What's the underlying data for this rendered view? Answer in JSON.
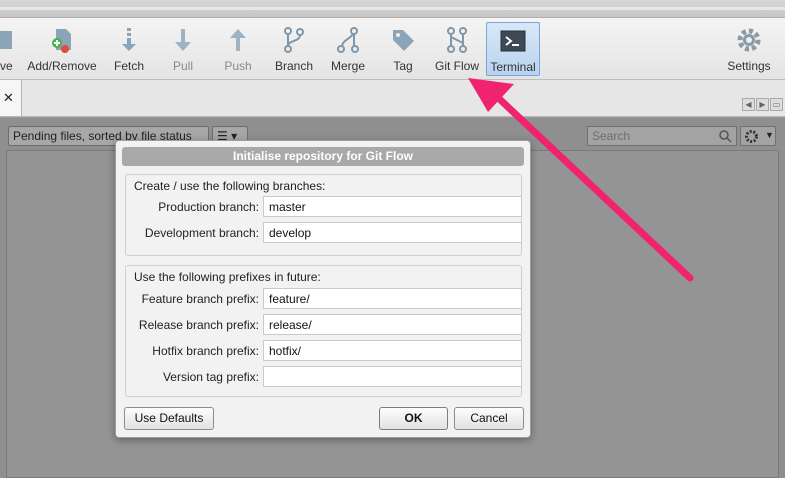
{
  "toolbar": {
    "items": [
      {
        "label": "ove",
        "icon": "remove-icon"
      },
      {
        "label": "Add/Remove",
        "icon": "add-remove-icon"
      },
      {
        "label": "Fetch",
        "icon": "fetch-icon"
      },
      {
        "label": "Pull",
        "icon": "pull-icon"
      },
      {
        "label": "Push",
        "icon": "push-icon"
      },
      {
        "label": "Branch",
        "icon": "branch-icon"
      },
      {
        "label": "Merge",
        "icon": "merge-icon"
      },
      {
        "label": "Tag",
        "icon": "tag-icon"
      },
      {
        "label": "Git Flow",
        "icon": "git-flow-icon"
      },
      {
        "label": "Terminal",
        "icon": "terminal-icon"
      },
      {
        "label": "Settings",
        "icon": "gear-icon"
      }
    ]
  },
  "tabs": {
    "close_label": "✕"
  },
  "filter": {
    "status_combo": "Pending files, sorted by file status",
    "search_placeholder": "Search"
  },
  "dialog": {
    "title": "Initialise repository for Git Flow",
    "branches_group": {
      "title": "Create / use the following branches:",
      "production_label": "Production branch:",
      "production_value": "master",
      "development_label": "Development branch:",
      "development_value": "develop"
    },
    "prefixes_group": {
      "title": "Use the following prefixes in future:",
      "feature_label": "Feature branch prefix:",
      "feature_value": "feature/",
      "release_label": "Release branch prefix:",
      "release_value": "release/",
      "hotfix_label": "Hotfix branch prefix:",
      "hotfix_value": "hotfix/",
      "version_label": "Version tag prefix:",
      "version_value": ""
    },
    "buttons": {
      "defaults": "Use Defaults",
      "ok": "OK",
      "cancel": "Cancel"
    }
  },
  "colors": {
    "annotation_arrow": "#f0246e",
    "active_button_bg": "#b9d3f0"
  }
}
